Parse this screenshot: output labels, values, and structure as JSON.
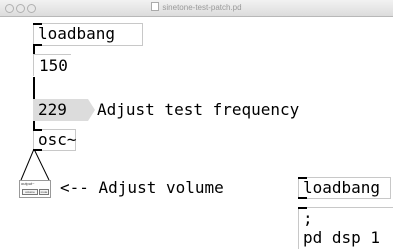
{
  "window": {
    "title": "sinetone-test-patch.pd"
  },
  "objects": {
    "loadbang_top": "loadbang",
    "osc": "osc~",
    "loadbang_bottom": "loadbang",
    "msg_line1": ";",
    "msg_line2": "pd dsp 1"
  },
  "numbers": {
    "delay_value": "150",
    "frequency_value": "229"
  },
  "comments": {
    "frequency": "Adjust test frequency",
    "volume": "<-- Adjust volume"
  },
  "volume_widget": {
    "label": "output~",
    "slots": [
      "volume",
      "mute"
    ]
  },
  "colors": {
    "number_box_fill": "#dcdcdc",
    "inlet": "#000000",
    "object_border": "#c8c8c8"
  }
}
